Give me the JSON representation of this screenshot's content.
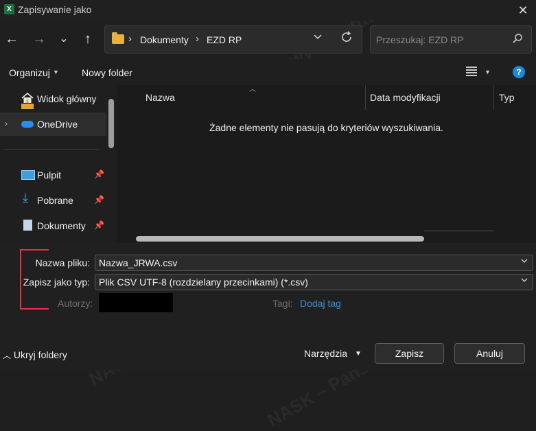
{
  "window": {
    "title": "Zapisywanie jako",
    "app_icon": "X",
    "close": "✕"
  },
  "nav": {
    "back": "←",
    "forward": "→",
    "recent": "⌄",
    "up": "↑"
  },
  "address": {
    "crumbs": [
      "Dokumenty",
      "EZD RP"
    ],
    "separator": "›"
  },
  "search": {
    "placeholder": "Przeszukaj: EZD RP"
  },
  "commandbar": {
    "organize": "Organizuj",
    "new_folder": "Nowy folder",
    "help": "?"
  },
  "sidebar": {
    "items": [
      {
        "label": "Widok główny",
        "icon": "home-icon"
      },
      {
        "label": "OneDrive",
        "icon": "cloud-icon"
      },
      {
        "label": "Pulpit",
        "icon": "desktop-icon",
        "pinned": true
      },
      {
        "label": "Pobrane",
        "icon": "download-icon",
        "pinned": true
      },
      {
        "label": "Dokumenty",
        "icon": "documents-icon",
        "pinned": true
      }
    ]
  },
  "filelist": {
    "columns": [
      "Nazwa",
      "Data modyfikacji",
      "Typ"
    ],
    "empty_message": "Żadne elementy nie pasują do kryteriów wyszukiwania."
  },
  "form": {
    "filename_label": "Nazwa pliku:",
    "filename_value": "Nazwa_JRWA.csv",
    "type_label": "Zapisz jako typ:",
    "type_value": "Plik CSV UTF-8 (rozdzielany przecinkami) (*.csv)",
    "authors_label": "Autorzy:",
    "tags_label": "Tagi:",
    "tags_link": "Dodaj tag"
  },
  "footer": {
    "hide_folders": "Ukryj foldery",
    "tools": "Narzędzia",
    "save": "Zapisz",
    "cancel": "Anuluj"
  },
  "colors": {
    "accent": "#1e86dd",
    "highlight_box": "#e8304a",
    "link": "#3f8ed6"
  }
}
